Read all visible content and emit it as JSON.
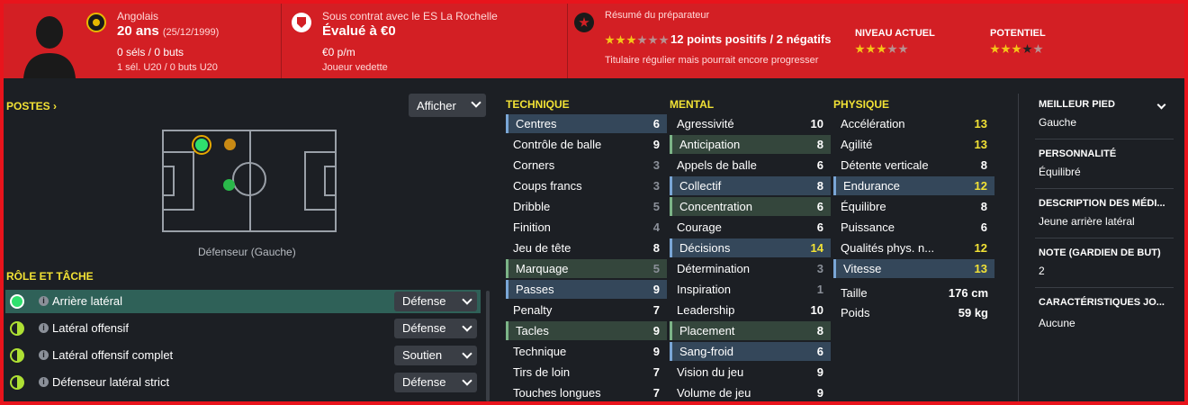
{
  "header": {
    "nationality": "Angolais",
    "age": "20 ans",
    "dob": "(25/12/1999)",
    "caps": "0 séls / 0 buts",
    "youth_caps": "1 sél. U20 / 0 buts U20",
    "contract": "Sous contrat avec le ES La Rochelle",
    "value": "Évalué à €0",
    "wage": "€0 p/m",
    "squad_status": "Joueur vedette",
    "report_title": "Résumé du préparateur",
    "report_points": "12 points positifs / 2 négatifs",
    "report_summary": "Titulaire régulier mais pourrait encore progresser",
    "current_label": "NIVEAU ACTUEL",
    "potential_label": "POTENTIEL",
    "report_stars": [
      1,
      1,
      1,
      0,
      0,
      0
    ],
    "current_stars": [
      1,
      1,
      1,
      0,
      0
    ],
    "potential_stars": [
      1,
      1,
      1,
      2,
      0
    ]
  },
  "positions": {
    "title": "POSTES",
    "show_button": "Afficher",
    "position_label": "Défenseur (Gauche)"
  },
  "roles": {
    "title": "RÔLE ET TÂCHE",
    "items": [
      {
        "name": "Arrière latéral",
        "duty": "Défense"
      },
      {
        "name": "Latéral offensif",
        "duty": "Défense"
      },
      {
        "name": "Latéral offensif complet",
        "duty": "Soutien"
      },
      {
        "name": "Défenseur latéral strict",
        "duty": "Défense"
      }
    ]
  },
  "technique": {
    "title": "TECHNIQUE",
    "items": [
      {
        "name": "Centres",
        "value": "6"
      },
      {
        "name": "Contrôle de balle",
        "value": "9"
      },
      {
        "name": "Corners",
        "value": "3"
      },
      {
        "name": "Coups francs",
        "value": "3"
      },
      {
        "name": "Dribble",
        "value": "5"
      },
      {
        "name": "Finition",
        "value": "4"
      },
      {
        "name": "Jeu de tête",
        "value": "8"
      },
      {
        "name": "Marquage",
        "value": "5"
      },
      {
        "name": "Passes",
        "value": "9"
      },
      {
        "name": "Penalty",
        "value": "7"
      },
      {
        "name": "Tacles",
        "value": "9"
      },
      {
        "name": "Technique",
        "value": "9"
      },
      {
        "name": "Tirs de loin",
        "value": "7"
      },
      {
        "name": "Touches longues",
        "value": "7"
      }
    ]
  },
  "mental": {
    "title": "MENTAL",
    "items": [
      {
        "name": "Agressivité",
        "value": "10"
      },
      {
        "name": "Anticipation",
        "value": "8"
      },
      {
        "name": "Appels de balle",
        "value": "6"
      },
      {
        "name": "Collectif",
        "value": "8"
      },
      {
        "name": "Concentration",
        "value": "6"
      },
      {
        "name": "Courage",
        "value": "6"
      },
      {
        "name": "Décisions",
        "value": "14"
      },
      {
        "name": "Détermination",
        "value": "3"
      },
      {
        "name": "Inspiration",
        "value": "1"
      },
      {
        "name": "Leadership",
        "value": "10"
      },
      {
        "name": "Placement",
        "value": "8"
      },
      {
        "name": "Sang-froid",
        "value": "6"
      },
      {
        "name": "Vision du jeu",
        "value": "9"
      },
      {
        "name": "Volume de jeu",
        "value": "9"
      }
    ]
  },
  "physique": {
    "title": "PHYSIQUE",
    "items": [
      {
        "name": "Accélération",
        "value": "13"
      },
      {
        "name": "Agilité",
        "value": "13"
      },
      {
        "name": "Détente verticale",
        "value": "8"
      },
      {
        "name": "Endurance",
        "value": "12"
      },
      {
        "name": "Équilibre",
        "value": "8"
      },
      {
        "name": "Puissance",
        "value": "6"
      },
      {
        "name": "Qualités phys. n...",
        "value": "12"
      },
      {
        "name": "Vitesse",
        "value": "13"
      }
    ],
    "height_label": "Taille",
    "height": "176 cm",
    "weight_label": "Poids",
    "weight": "59 kg"
  },
  "info": {
    "foot_label": "MEILLEUR PIED",
    "foot": "Gauche",
    "personality_label": "PERSONNALITÉ",
    "personality": "Équilibré",
    "media_label": "DESCRIPTION DES MÉDI...",
    "media": "Jeune arrière latéral",
    "gk_label": "NOTE (GARDIEN DE BUT)",
    "gk": "2",
    "traits_label": "CARACTÉRISTIQUES JO...",
    "traits": "Aucune"
  },
  "colors": {
    "accent": "#d31f24",
    "highlight": "#f2e235",
    "panel": "#1c1f24"
  }
}
